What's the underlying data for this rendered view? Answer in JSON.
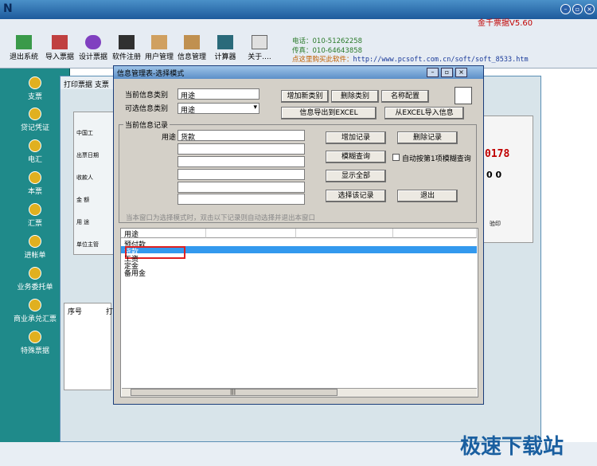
{
  "app": {
    "version_text": "金千票据V5.60",
    "logo": "N"
  },
  "toolbar": {
    "items": [
      "退出系统",
      "导入票据",
      "设计票据",
      "软件注册",
      "用户管理",
      "信息管理",
      "计算器",
      "关于...."
    ],
    "phone": "电话：010-51262258",
    "fax": "传真：010-64643858",
    "buy_label": "点这里购买此软件：",
    "buy_url": "http://www.pcsoft.com.cn/soft/soft_8533.htm"
  },
  "sidebar": {
    "items": [
      "支票",
      "贷记凭证",
      "电汇",
      "本票",
      "汇票",
      "进帐单",
      "业务委托单",
      "商业承兑汇票",
      "特殊票据"
    ]
  },
  "background": {
    "tabs": "打印票据  支票",
    "cheque_lines": [
      "中国工",
      "出票日期",
      "收款人",
      "金  额",
      "用  途",
      "单位主管"
    ],
    "digits": "0178",
    "digits2": "0 0",
    "table_header": [
      "序号",
      "打"
    ],
    "right_label": "验印"
  },
  "dialog": {
    "title": "信息管理表-选择模式",
    "current_category_label": "当前信息类别",
    "current_category_value": "用途",
    "optional_category_label": "可选信息类别",
    "optional_category_value": "用途",
    "btn_add_category": "增加新类别",
    "btn_delete_category": "删除类别",
    "btn_name_config": "名称配置",
    "btn_export_excel": "信息导出到EXCEL",
    "btn_import_excel": "从EXCEL导入信息",
    "group_label": "当前信息记录",
    "field_label": "用途",
    "field_value": "货款",
    "btn_add_record": "增加记录",
    "btn_delete_record": "删除记录",
    "btn_fuzzy_query": "模糊查询",
    "auto_fuzzy_label": "自动按第1项模糊查询",
    "btn_show_all": "显示全部",
    "btn_select_record": "选择该记录",
    "btn_exit": "退出",
    "hint": "当本窗口为选择模式时，双击以下记录则自动选择并退出本窗口",
    "grid_header": "用途",
    "rows": [
      "预付款",
      "货款",
      "工资",
      "定金",
      "备用金"
    ],
    "scroll_label": "|||"
  },
  "watermark": "极速下载站"
}
